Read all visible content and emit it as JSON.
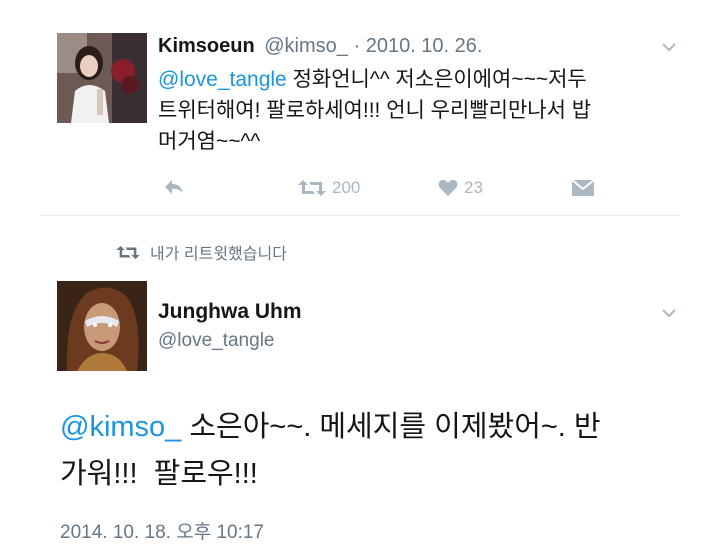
{
  "tweet1": {
    "display_name": "Kimsoeun",
    "handle": "@kimso_",
    "separator": "·",
    "date": "2010. 10. 26.",
    "mention": "@love_tangle",
    "line1_rest": " 정화언니^^ 저소은이에여~~~저두",
    "line2": "트위터해여! 팔로하세여!!! 언니 우리빨리만나서 밥",
    "line3": "머거염~~^^",
    "actions": {
      "reply_icon": "reply-icon",
      "retweet_icon": "retweet-icon",
      "retweet_count": "200",
      "like_icon": "heart-icon",
      "like_count": "23",
      "dm_icon": "envelope-icon"
    }
  },
  "retweet_notice": {
    "icon": "retweet-icon",
    "text": "내가 리트윗했습니다"
  },
  "tweet2": {
    "display_name": "Junghwa Uhm",
    "handle": "@love_tangle",
    "mention": "@kimso_",
    "line1_rest": " 소은아~~. 메세지를 이제봤어~. 반",
    "line2": "가워!!!  팔로우!!!",
    "timestamp": "2014. 10. 18. 오후 10:17"
  },
  "colors": {
    "link": "#1b95e0",
    "secondary_text": "#657786",
    "action_icon": "#aab8c2",
    "divider": "#e6ecf0"
  }
}
